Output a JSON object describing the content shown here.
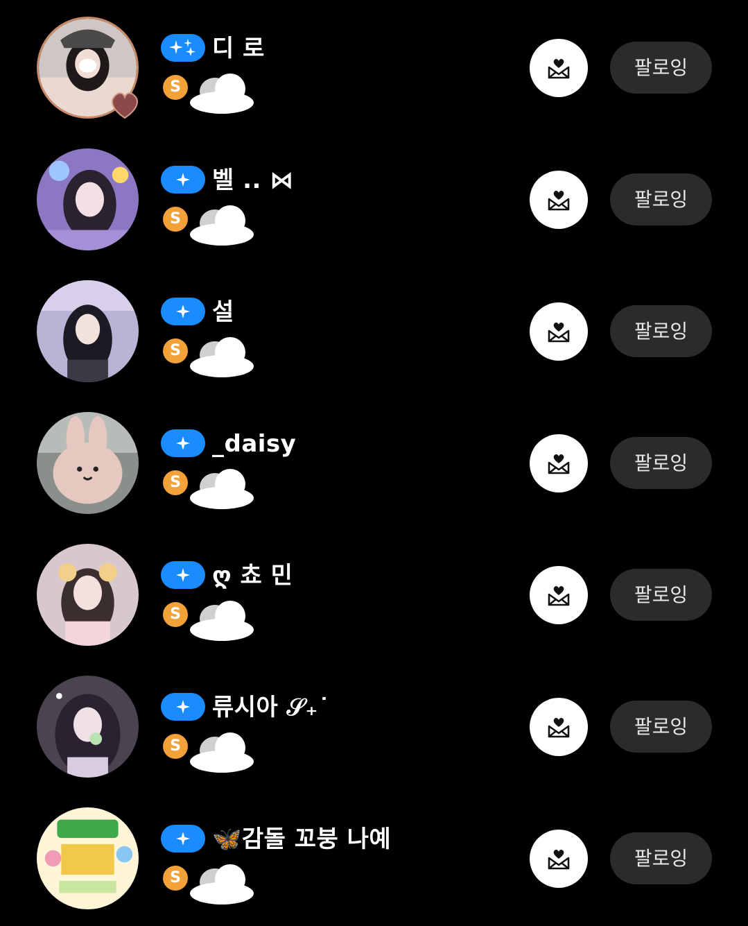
{
  "colors": {
    "background": "#000000",
    "badge": "#1a8cff",
    "coin": "#f3a23a",
    "follow_button_bg": "#2b2b2b",
    "follow_button_text": "#e8e8e8",
    "gift_button_bg": "#ffffff"
  },
  "follow_list": [
    {
      "name": "디 로",
      "badge_icon": "sparkles-icon",
      "coin_letter": "S",
      "button_label": "팔로잉",
      "gift_icon": "heart-envelope-icon"
    },
    {
      "name": "벨 .. ⋈",
      "badge_icon": "sparkle-icon",
      "coin_letter": "S",
      "button_label": "팔로잉",
      "gift_icon": "heart-envelope-icon"
    },
    {
      "name": "설",
      "badge_icon": "sparkle-icon",
      "coin_letter": "S",
      "button_label": "팔로잉",
      "gift_icon": "heart-envelope-icon"
    },
    {
      "name": "_daisy",
      "badge_icon": "sparkle-icon",
      "coin_letter": "S",
      "button_label": "팔로잉",
      "gift_icon": "heart-envelope-icon"
    },
    {
      "name": "ღ 쵸 민",
      "badge_icon": "sparkle-icon",
      "coin_letter": "S",
      "button_label": "팔로잉",
      "gift_icon": "heart-envelope-icon"
    },
    {
      "name": "류시아 𝒮₊˙",
      "badge_icon": "sparkle-icon",
      "coin_letter": "S",
      "button_label": "팔로잉",
      "gift_icon": "heart-envelope-icon"
    },
    {
      "name": "🦋감돌 꼬붕 나예",
      "badge_icon": "sparkle-icon",
      "coin_letter": "S",
      "button_label": "팔로잉",
      "gift_icon": "heart-envelope-icon"
    }
  ]
}
